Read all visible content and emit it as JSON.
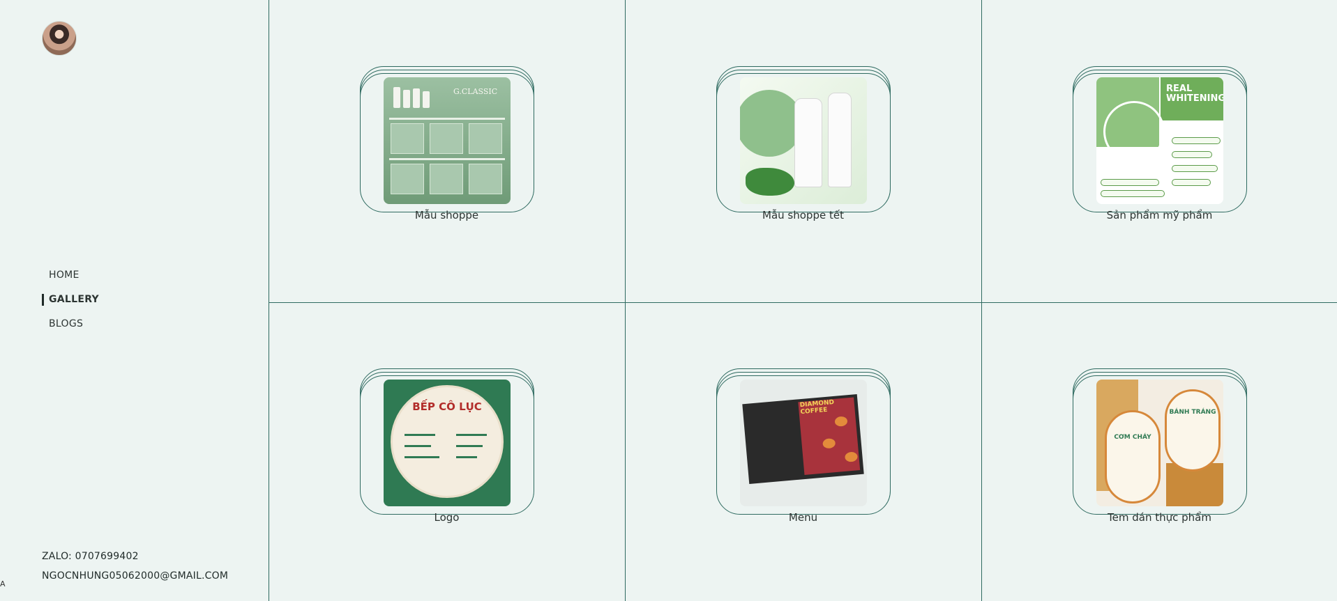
{
  "sidebar": {
    "nav": [
      {
        "label": "HOME"
      },
      {
        "label": "GALLERY",
        "active": true
      },
      {
        "label": "BLOGS"
      }
    ],
    "contact": {
      "zalo": "ZALO: 0707699402",
      "email": "NGOCNHUNG05062000@GMAIL.COM"
    },
    "stray_text": "A"
  },
  "gallery": {
    "items": [
      {
        "caption": "Mẫu shoppe",
        "brand": "G.CLASSIC"
      },
      {
        "caption": "Mẫu shoppe tết"
      },
      {
        "caption": "Sản phẩm mỹ phẩm",
        "title": "REAL WHITENING"
      },
      {
        "caption": "Logo",
        "name": "BẾP CÔ LỤC"
      },
      {
        "caption": "Menu",
        "header": "DIAMOND COFFEE"
      },
      {
        "caption": "Tem dán thực phẩm",
        "label_left": "CƠM CHÁY",
        "label_right": "BÁNH TRÁNG"
      }
    ]
  },
  "colors": {
    "background": "#edf4f2",
    "accent": "#2e6a60",
    "text": "#1f2a28"
  }
}
